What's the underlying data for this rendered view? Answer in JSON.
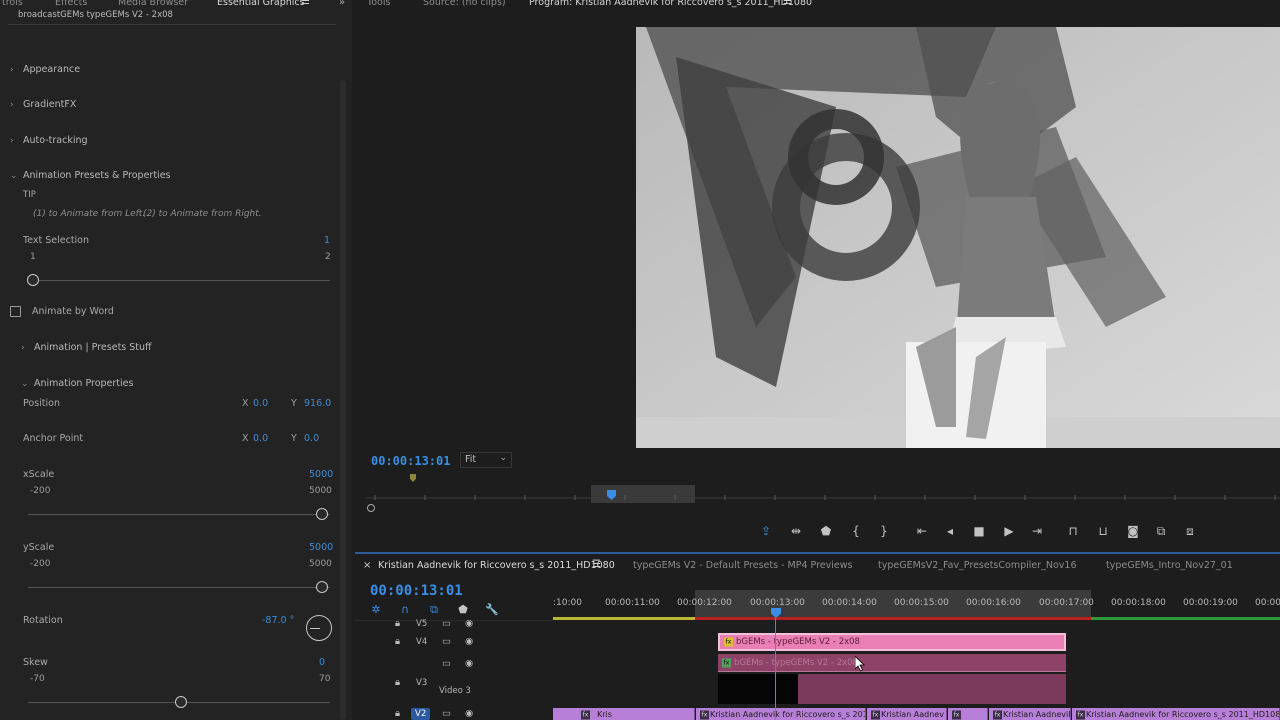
{
  "left_panel": {
    "tabs": [
      "trols",
      "Effects",
      "Media Browser",
      "Essential Graphics"
    ],
    "menu_icon": "hamburger-icon",
    "clip_name": "broadcastGEMs typeGEMs V2 - 2x08",
    "sections": {
      "appearance": "Appearance",
      "gradientfx": "GradientFX",
      "autotracking": "Auto-tracking",
      "anim_presets": "Animation Presets & Properties",
      "tip_label": "TIP",
      "tip_left": "(1) to Animate from Left.",
      "tip_right": "(2) to Animate from Right.",
      "text_selection": "Text Selection",
      "text_selection_value": "1",
      "ts_min": "1",
      "ts_max": "2",
      "animate_by_word": "Animate by Word",
      "anim_presets_stuff": "Animation | Presets Stuff",
      "anim_properties": "Animation Properties"
    },
    "position": {
      "label": "Position",
      "x_label": "X",
      "x": "0.0",
      "y_label": "Y",
      "y": "916.0"
    },
    "anchor": {
      "label": "Anchor Point",
      "x_label": "X",
      "x": "0.0",
      "y_label": "Y",
      "y": "0.0"
    },
    "xscale": {
      "label": "xScale",
      "value": "5000",
      "min": "-200",
      "max": "5000"
    },
    "yscale": {
      "label": "yScale",
      "value": "5000",
      "min": "-200",
      "max": "5000"
    },
    "rotation": {
      "label": "Rotation",
      "value": "-87.0 °"
    },
    "skew": {
      "label": "Skew",
      "value": "0",
      "min": "-70",
      "max": "70"
    }
  },
  "monitor": {
    "tabs": [
      "Tools",
      "Source: (no clips)",
      "Program: Kristian Aadnevik for Riccovero s_s 2011_HD1080"
    ],
    "timecode": "00:00:13:01",
    "fit": "Fit",
    "transport_icons": [
      "export-frame-icon",
      "trim-icon",
      "add-marker-icon",
      "mark-in-icon",
      "mark-out-icon",
      "go-to-in-icon",
      "step-back-icon",
      "stop-icon",
      "play-icon",
      "step-forward-icon",
      "lift-icon",
      "extract-icon",
      "camera-icon",
      "compare-icon",
      "settings-icon"
    ]
  },
  "timeline": {
    "tabs": [
      "Kristian Aadnevik for Riccovero s_s 2011_HD1080",
      "typeGEMs V2 - Default Presets - MP4 Previews",
      "typeGEMsV2_Fav_PresetsCompiler_Nov16",
      "typeGEMs_Intro_Nov27_01"
    ],
    "close": "×",
    "timecode": "00:00:13:01",
    "ruler_ticks": [
      ":10:00",
      "00:00:11:00",
      "00:00:12:00",
      "00:00:13:00",
      "00:00:14:00",
      "00:00:15:00",
      "00:00:16:00",
      "00:00:17:00",
      "00:00:18:00",
      "00:00:19:00",
      "00:00"
    ],
    "tracks": {
      "v5": "V5",
      "v4": "V4",
      "v3": "V3",
      "v3_name": "Video 3",
      "v2": "V2"
    },
    "clips": {
      "v4_clip": "bGEMs - typeGEMs V2 - 2x08",
      "v3_clip": "bGEMs - typeGEMs V2 - 2x08",
      "v2_clips": [
        "Kris",
        "Kristian Aadnevik for Riccovero s_s 2011_",
        "Kristian Aadnev",
        "",
        "Kristian Aadnevik",
        "Kristian Aadnevik for Riccovero s_s 2011_HD1080"
      ]
    }
  },
  "colors": {
    "accent": "#3a8ee6",
    "clip_pink": "#e97fb4",
    "clip_pink_dark": "#8e4268",
    "clip_purple": "#b87fd8"
  }
}
